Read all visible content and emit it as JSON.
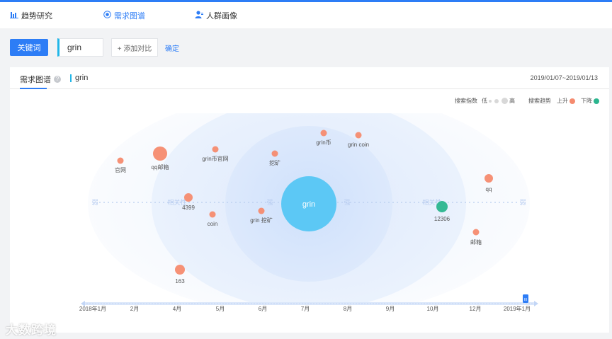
{
  "nav": {
    "items": [
      {
        "label": "趋势研究",
        "icon": "chart-icon",
        "active": false
      },
      {
        "label": "需求图谱",
        "icon": "radar-icon",
        "active": true
      },
      {
        "label": "人群画像",
        "icon": "user-icon",
        "active": false
      }
    ]
  },
  "toolbar": {
    "keyword_button": "关键词",
    "keyword_value": "grin",
    "add_compare": "+ 添加对比",
    "confirm": "确定"
  },
  "card": {
    "tab": "需求图谱",
    "keyword_tag": "grin",
    "date_range": "2019/01/07~2019/01/13",
    "legend": {
      "search_index_label": "搜索指数",
      "low": "低",
      "high": "高",
      "trend_label": "搜索趋势",
      "up": "上升",
      "down": "下降",
      "up_color": "#f58b6f",
      "down_color": "#2bb58e"
    }
  },
  "graph": {
    "axis": {
      "weak": "弱",
      "relevance": "相关性",
      "strong": "强"
    },
    "center": {
      "label": "grin",
      "color": "#5cc8f5"
    },
    "nodes": [
      {
        "label": "官网",
        "trend": "up"
      },
      {
        "label": "qq邮箱",
        "trend": "up"
      },
      {
        "label": "grin币官网",
        "trend": "up"
      },
      {
        "label": "挖矿",
        "trend": "up"
      },
      {
        "label": "grin币",
        "trend": "up"
      },
      {
        "label": "grin coin",
        "trend": "up"
      },
      {
        "label": "qq",
        "trend": "up"
      },
      {
        "label": "4399",
        "trend": "up"
      },
      {
        "label": "coin",
        "trend": "up"
      },
      {
        "label": "grin 挖矿",
        "trend": "up"
      },
      {
        "label": "12306",
        "trend": "down"
      },
      {
        "label": "邮箱",
        "trend": "up"
      },
      {
        "label": "163",
        "trend": "up"
      }
    ]
  },
  "timeline": {
    "months": [
      "2018年1月",
      "2月",
      "4月",
      "5月",
      "6月",
      "7月",
      "8月",
      "9月",
      "10月",
      "12月",
      "2019年1月"
    ],
    "handle_label": "III"
  },
  "watermark": "大数跨境"
}
